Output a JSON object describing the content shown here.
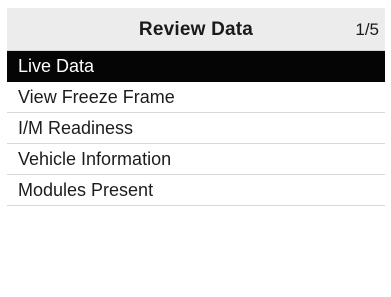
{
  "header": {
    "title": "Review Data",
    "page_indicator": "1/5"
  },
  "menu": {
    "selected_index": 0,
    "items": [
      {
        "label": "Live Data"
      },
      {
        "label": "View Freeze Frame"
      },
      {
        "label": "I/M Readiness"
      },
      {
        "label": "Vehicle Information"
      },
      {
        "label": "Modules Present"
      }
    ]
  },
  "colors": {
    "header_bg": "#ececec",
    "selected_bg": "#050505",
    "selected_text": "#ffffff",
    "text": "#1c1c1c",
    "divider": "#d8d8d8"
  }
}
